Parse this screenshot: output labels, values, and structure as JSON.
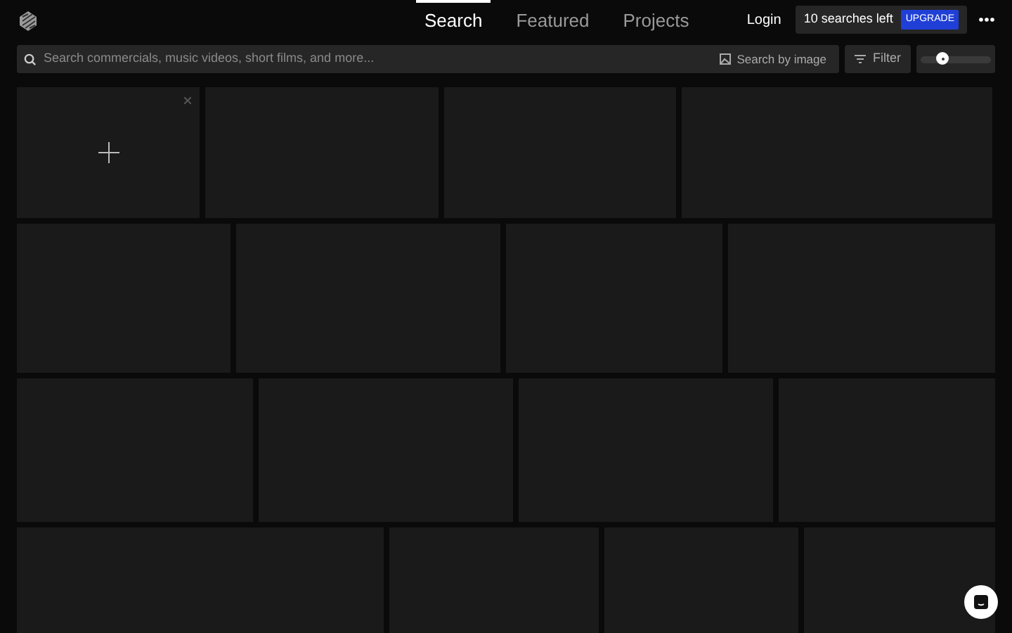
{
  "nav": {
    "tabs": [
      {
        "label": "Search",
        "selected": true
      },
      {
        "label": "Featured",
        "selected": false
      },
      {
        "label": "Projects",
        "selected": false
      }
    ],
    "login": "Login",
    "searches_left": "10 searches left",
    "upgrade": "UPGRADE"
  },
  "search": {
    "placeholder": "Search commercials, music videos, short films, and more...",
    "by_image": "Search by image",
    "filter": "Filter"
  }
}
